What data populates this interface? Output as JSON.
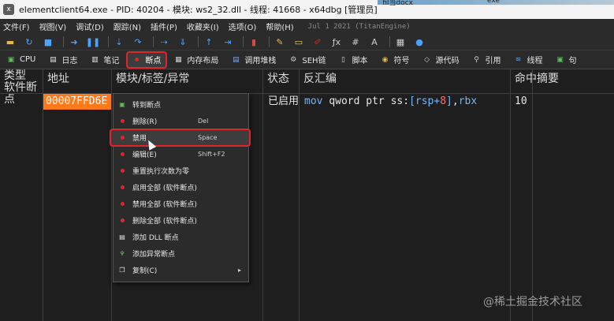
{
  "window": {
    "title": "elementclient64.exe - PID: 40204 - 模块: ws2_32.dll - 线程: 41668 - x64dbg [管理员]",
    "bg_text_1": "fil当docx",
    "bg_text_2": "exe"
  },
  "menubar": {
    "items": [
      "文件(F)",
      "视图(V)",
      "调试(D)",
      "跟踪(N)",
      "插件(P)",
      "收藏夹(I)",
      "选项(O)",
      "帮助(H)"
    ],
    "build": "Jul 1 2021 (TitanEngine)"
  },
  "toolbar": {
    "icons": [
      "open-icon",
      "restart-icon",
      "stop-icon",
      "run-icon",
      "pause-icon",
      "step-into-icon",
      "step-over-icon",
      "trace-into-icon",
      "trace-over-icon",
      "execute-till-return-icon",
      "run-to-user-code-icon",
      "script-icon",
      "edit-icon",
      "patch-icon",
      "highlight-icon",
      "fx-icon",
      "hash-icon",
      "comment-icon",
      "label-icon"
    ]
  },
  "tabs": [
    {
      "label": "CPU",
      "icon": "cpu-icon"
    },
    {
      "label": "日志",
      "icon": "log-icon"
    },
    {
      "label": "笔记",
      "icon": "notes-icon"
    },
    {
      "label": "断点",
      "icon": "breakpoint-icon",
      "active": true
    },
    {
      "label": "内存布局",
      "icon": "memory-map-icon"
    },
    {
      "label": "调用堆栈",
      "icon": "call-stack-icon"
    },
    {
      "label": "SEH链",
      "icon": "seh-icon"
    },
    {
      "label": "脚本",
      "icon": "script-icon"
    },
    {
      "label": "符号",
      "icon": "symbols-icon"
    },
    {
      "label": "源代码",
      "icon": "source-icon"
    },
    {
      "label": "引用",
      "icon": "references-icon"
    },
    {
      "label": "线程",
      "icon": "threads-icon"
    },
    {
      "label": "句",
      "icon": "handles-icon"
    }
  ],
  "grid": {
    "headers": {
      "type": "类型",
      "type_sub": "软件断点",
      "address": "地址",
      "module": "模块/标签/异常",
      "state": "状态",
      "disasm": "反汇编",
      "hits": "命中",
      "summary": "摘要"
    },
    "row": {
      "address": "00007FFD6E",
      "state": "已启用",
      "disasm_mnemonic": "mov",
      "disasm_size": "qword",
      "disasm_ptr": "ptr",
      "disasm_seg": "ss",
      "disasm_reg1": "rsp",
      "disasm_plus": "+",
      "disasm_imm": "8",
      "disasm_reg2": "rbx",
      "hits": "10"
    }
  },
  "context_menu": {
    "items": [
      {
        "label": "转到断点",
        "shortcut": "",
        "icon": "goto-icon"
      },
      {
        "label": "删除(R)",
        "shortcut": "Del",
        "icon": "delete-icon"
      },
      {
        "label": "禁用",
        "shortcut": "Space",
        "icon": "disable-icon",
        "highlighted": true
      },
      {
        "label": "编辑(E)",
        "shortcut": "Shift+F2",
        "icon": "edit-icon"
      },
      {
        "label": "重置执行次数为零",
        "shortcut": "",
        "icon": "reset-icon"
      },
      {
        "label": "启用全部 (软件断点)",
        "shortcut": "",
        "icon": "enable-all-icon"
      },
      {
        "label": "禁用全部 (软件断点)",
        "shortcut": "",
        "icon": "disable-all-icon"
      },
      {
        "label": "删除全部 (软件断点)",
        "shortcut": "",
        "icon": "delete-all-icon"
      },
      {
        "label": "添加 DLL 断点",
        "shortcut": "",
        "icon": "dll-icon"
      },
      {
        "label": "添加异常断点",
        "shortcut": "",
        "icon": "exception-icon"
      },
      {
        "label": "复制(C)",
        "shortcut": "",
        "icon": "copy-icon",
        "submenu": true
      }
    ]
  },
  "watermark": "@稀土掘金技术社区",
  "colors": {
    "highlight_red": "#e0242b",
    "address_bg": "#ff7a1a",
    "keyword_blue": "#6fb7ff",
    "number_red": "#ff6b6b"
  }
}
